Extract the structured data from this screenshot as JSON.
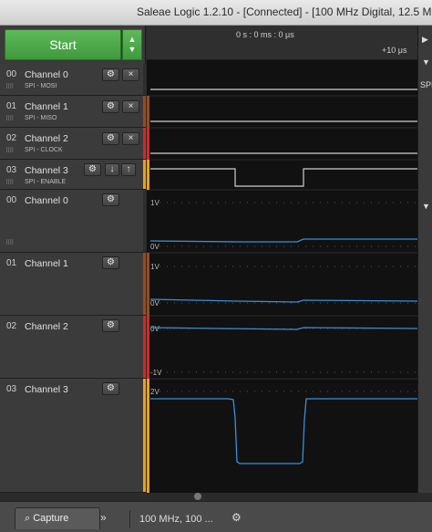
{
  "window": {
    "title": "Saleae Logic 1.2.10 - [Connected] - [100 MHz Digital, 12.5 M"
  },
  "start": {
    "label": "Start"
  },
  "timeline": {
    "center": "0 s : 0 ms : 0 μs",
    "tick": "+10 μs"
  },
  "right_panel": {
    "label": "SPI"
  },
  "channels": [
    {
      "num": "00",
      "name": "Channel 0",
      "sub": "SPI - MOSI"
    },
    {
      "num": "01",
      "name": "Channel 1",
      "sub": "SPI - MISO"
    },
    {
      "num": "02",
      "name": "Channel 2",
      "sub": "SPI - CLOCK"
    },
    {
      "num": "03",
      "name": "Channel 3",
      "sub": "SPI - ENABLE"
    },
    {
      "num": "00",
      "name": "Channel 0"
    },
    {
      "num": "01",
      "name": "Channel 1"
    },
    {
      "num": "02",
      "name": "Channel 2"
    },
    {
      "num": "03",
      "name": "Channel 3"
    }
  ],
  "analog_labels": {
    "ch0_top": "1V",
    "ch0_bot": "0V",
    "ch1_top": "1V",
    "ch1_bot": "0V",
    "ch2_top": "0V",
    "ch2_bot": "-1V",
    "ch3_top": "2V"
  },
  "bottom": {
    "capture": "Capture",
    "status": "100 MHz, 100 ..."
  },
  "colors": {
    "ch0": "#2e2e2e",
    "ch1": "#9b4a1c",
    "ch2": "#d02a2a",
    "ch3": "#e8a020",
    "start": "#4caa48",
    "analog": "#3b8ed8"
  },
  "icons": [
    "gear-icon",
    "close-icon",
    "up-down-arrows-icon",
    "chevron-icon",
    "magnifier-icon"
  ]
}
